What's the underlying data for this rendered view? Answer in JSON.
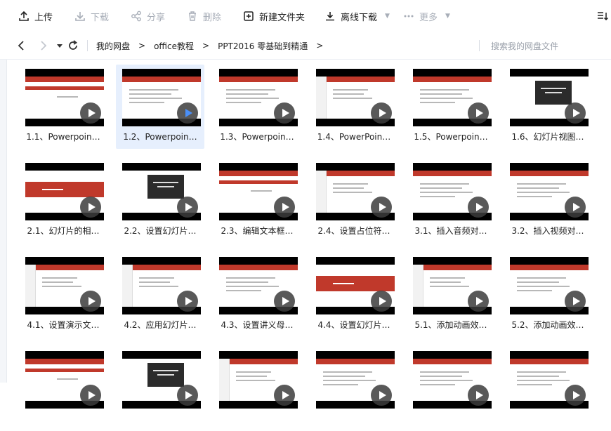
{
  "toolbar": {
    "upload": "上传",
    "download": "下载",
    "share": "分享",
    "delete": "删除",
    "new_folder": "新建文件夹",
    "offline_download": "离线下载",
    "more": "更多"
  },
  "nav": {
    "breadcrumbs": [
      "我的网盘",
      "office教程",
      "PPT2016 零基础到精通"
    ],
    "search_placeholder": "搜索我的网盘文件"
  },
  "files": [
    {
      "label": "1.1、Powerpoin…",
      "style": "title"
    },
    {
      "label": "1.2、Powerpoin…",
      "style": "text",
      "selected": true
    },
    {
      "label": "1.3、Powerpoin…",
      "style": "text"
    },
    {
      "label": "1.4、PowerPoin…",
      "style": "side"
    },
    {
      "label": "1.5、Powerpoin…",
      "style": "text"
    },
    {
      "label": "1.6、幻灯片视图…",
      "style": "dark"
    },
    {
      "label": "2.1、幻灯片的相…",
      "style": "band"
    },
    {
      "label": "2.2、设置幻灯片…",
      "style": "dark"
    },
    {
      "label": "2.3、编辑文本框…",
      "style": "title"
    },
    {
      "label": "2.4、设置占位符…",
      "style": "side"
    },
    {
      "label": "3.1、插入音频对…",
      "style": "text"
    },
    {
      "label": "3.2、插入视频对…",
      "style": "text"
    },
    {
      "label": "4.1、设置演示文…",
      "style": "side"
    },
    {
      "label": "4.2、应用幻灯片…",
      "style": "side"
    },
    {
      "label": "4.3、设置讲义母…",
      "style": "text"
    },
    {
      "label": "4.4、设置幻灯片…",
      "style": "band"
    },
    {
      "label": "5.1、添加动画效…",
      "style": "side"
    },
    {
      "label": "5.2、添加动画效…",
      "style": "text"
    },
    {
      "label": "",
      "style": "title"
    },
    {
      "label": "",
      "style": "dark"
    },
    {
      "label": "",
      "style": "side"
    },
    {
      "label": "",
      "style": "text"
    },
    {
      "label": "",
      "style": "text"
    },
    {
      "label": "",
      "style": "text"
    }
  ]
}
